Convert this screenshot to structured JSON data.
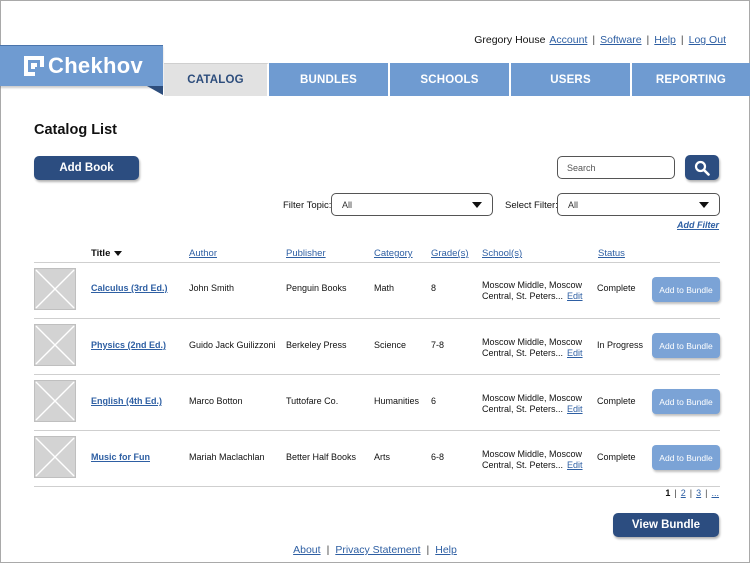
{
  "user_nav": {
    "user_name": "Gregory House",
    "links": [
      "Account",
      "Software",
      "Help",
      "Log Out"
    ],
    "separator": "|"
  },
  "brand": {
    "name": "Chekhov",
    "icon": "chekhov-logo-icon"
  },
  "tabs": [
    {
      "label": "CATALOG",
      "active": true
    },
    {
      "label": "BUNDLES",
      "active": false
    },
    {
      "label": "SCHOOLS",
      "active": false
    },
    {
      "label": "USERS",
      "active": false
    },
    {
      "label": "REPORTING",
      "active": false
    }
  ],
  "page_title": "Catalog List",
  "add_book_label": "Add Book",
  "search": {
    "placeholder": "Search",
    "icon": "search-icon"
  },
  "filters": {
    "topic_label": "Filter Topic:",
    "topic_value": "All",
    "select_label": "Select Filter:",
    "select_value": "All",
    "add_filter_label": "Add Filter"
  },
  "table": {
    "columns": [
      "Title",
      "Author",
      "Publisher",
      "Category",
      "Grade(s)",
      "School(s)",
      "Status"
    ],
    "rows": [
      {
        "title": "Calculus (3rd Ed.)",
        "author": "John Smith",
        "publisher": "Penguin Books",
        "category": "Math",
        "grades": "8",
        "schools_line1": "Moscow Middle, Moscow",
        "schools_line2": "Central, St. Peters...",
        "edit": "Edit",
        "status": "Complete",
        "action": "Add to Bundle"
      },
      {
        "title": "Physics (2nd Ed.)",
        "author": "Guido Jack Guilizzoni",
        "publisher": "Berkeley Press",
        "category": "Science",
        "grades": "7-8",
        "schools_line1": "Moscow Middle, Moscow",
        "schools_line2": "Central, St. Peters...",
        "edit": "Edit",
        "status": "In Progress",
        "action": "Add to Bundle"
      },
      {
        "title": "English (4th Ed.)",
        "author": "Marco Botton",
        "publisher": "Tuttofare Co.",
        "category": "Humanities",
        "grades": "6",
        "schools_line1": "Moscow Middle, Moscow",
        "schools_line2": "Central, St. Peters...",
        "edit": "Edit",
        "status": "Complete",
        "action": "Add to Bundle"
      },
      {
        "title": "Music for Fun",
        "author": "Mariah Maclachlan",
        "publisher": "Better Half Books",
        "category": "Arts",
        "grades": "6-8",
        "schools_line1": "Moscow Middle, Moscow",
        "schools_line2": "Central, St. Peters...",
        "edit": "Edit",
        "status": "Complete",
        "action": "Add to Bundle"
      }
    ]
  },
  "pagination": {
    "current": "1",
    "pages": [
      "2",
      "3"
    ],
    "more": "..."
  },
  "view_bundle_label": "View Bundle",
  "footer": {
    "links": [
      "About",
      "Privacy Statement",
      "Help"
    ]
  },
  "colors": {
    "primary_dark": "#2c4d80",
    "primary_light": "#6f9bd1",
    "link": "#2e5fa3",
    "tab_active_bg": "#e2e2e2"
  }
}
